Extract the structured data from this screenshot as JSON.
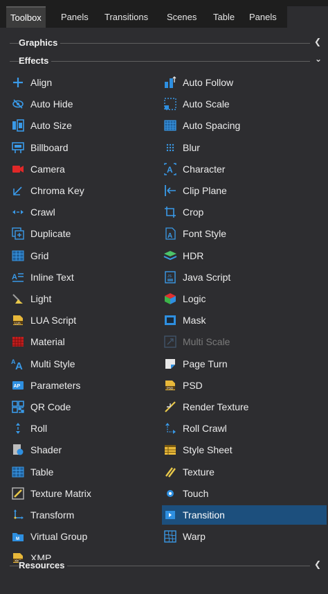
{
  "tabs": [
    {
      "label": "Toolbox",
      "active": true
    },
    {
      "label": "Panels"
    },
    {
      "label": "Transitions"
    },
    {
      "label": "Scenes"
    },
    {
      "label": "Table"
    },
    {
      "label": "Panels"
    }
  ],
  "sections": {
    "graphics": {
      "title": "Graphics",
      "state": "collapsed"
    },
    "effects": {
      "title": "Effects",
      "state": "expanded"
    },
    "resources": {
      "title": "Resources",
      "state": "collapsed"
    }
  },
  "effects_left": [
    {
      "label": "Align",
      "icon": "align-icon"
    },
    {
      "label": "Auto Hide",
      "icon": "eye-slash-icon"
    },
    {
      "label": "Auto Size",
      "icon": "auto-size-icon"
    },
    {
      "label": "Billboard",
      "icon": "billboard-icon"
    },
    {
      "label": "Camera",
      "icon": "camera-icon"
    },
    {
      "label": "Chroma Key",
      "icon": "chroma-key-icon"
    },
    {
      "label": "Crawl",
      "icon": "crawl-icon"
    },
    {
      "label": "Duplicate",
      "icon": "duplicate-icon"
    },
    {
      "label": "Grid",
      "icon": "grid-icon"
    },
    {
      "label": "Inline Text",
      "icon": "inline-text-icon"
    },
    {
      "label": "Light",
      "icon": "light-icon"
    },
    {
      "label": "LUA Script",
      "icon": "lua-script-icon"
    },
    {
      "label": "Material",
      "icon": "material-icon"
    },
    {
      "label": "Multi Style",
      "icon": "multi-style-icon"
    },
    {
      "label": "Parameters",
      "icon": "parameters-icon"
    },
    {
      "label": "QR Code",
      "icon": "qr-code-icon"
    },
    {
      "label": "Roll",
      "icon": "roll-icon"
    },
    {
      "label": "Shader",
      "icon": "shader-icon"
    },
    {
      "label": "Table",
      "icon": "table-icon"
    },
    {
      "label": "Texture Matrix",
      "icon": "texture-matrix-icon"
    },
    {
      "label": "Transform",
      "icon": "transform-icon"
    },
    {
      "label": "Virtual Group",
      "icon": "virtual-group-icon"
    },
    {
      "label": "XMP",
      "icon": "xmp-icon"
    }
  ],
  "effects_right": [
    {
      "label": "Auto Follow",
      "icon": "auto-follow-icon"
    },
    {
      "label": "Auto Scale",
      "icon": "auto-scale-icon"
    },
    {
      "label": "Auto Spacing",
      "icon": "auto-spacing-icon"
    },
    {
      "label": "Blur",
      "icon": "blur-icon"
    },
    {
      "label": "Character",
      "icon": "character-icon"
    },
    {
      "label": "Clip Plane",
      "icon": "clip-plane-icon"
    },
    {
      "label": "Crop",
      "icon": "crop-icon"
    },
    {
      "label": "Font Style",
      "icon": "font-style-icon"
    },
    {
      "label": "HDR",
      "icon": "hdr-icon"
    },
    {
      "label": "Java Script",
      "icon": "java-script-icon"
    },
    {
      "label": "Logic",
      "icon": "logic-icon"
    },
    {
      "label": "Mask",
      "icon": "mask-icon"
    },
    {
      "label": "Multi Scale",
      "icon": "multi-scale-icon",
      "disabled": true
    },
    {
      "label": "Page Turn",
      "icon": "page-turn-icon"
    },
    {
      "label": "PSD",
      "icon": "psd-icon"
    },
    {
      "label": "Render Texture",
      "icon": "render-texture-icon"
    },
    {
      "label": "Roll Crawl",
      "icon": "roll-crawl-icon"
    },
    {
      "label": "Style Sheet",
      "icon": "style-sheet-icon"
    },
    {
      "label": "Texture",
      "icon": "texture-icon"
    },
    {
      "label": "Touch",
      "icon": "touch-icon"
    },
    {
      "label": "Transition",
      "icon": "transition-icon",
      "selected": true
    },
    {
      "label": "Warp",
      "icon": "warp-icon"
    }
  ],
  "colors": {
    "background": "#2d2d30",
    "tabbar": "#1e1e1e",
    "selection": "#1c4f7d",
    "accent_blue": "#2e8fe0",
    "text": "#ececec",
    "disabled_text": "#7a7a7a"
  }
}
